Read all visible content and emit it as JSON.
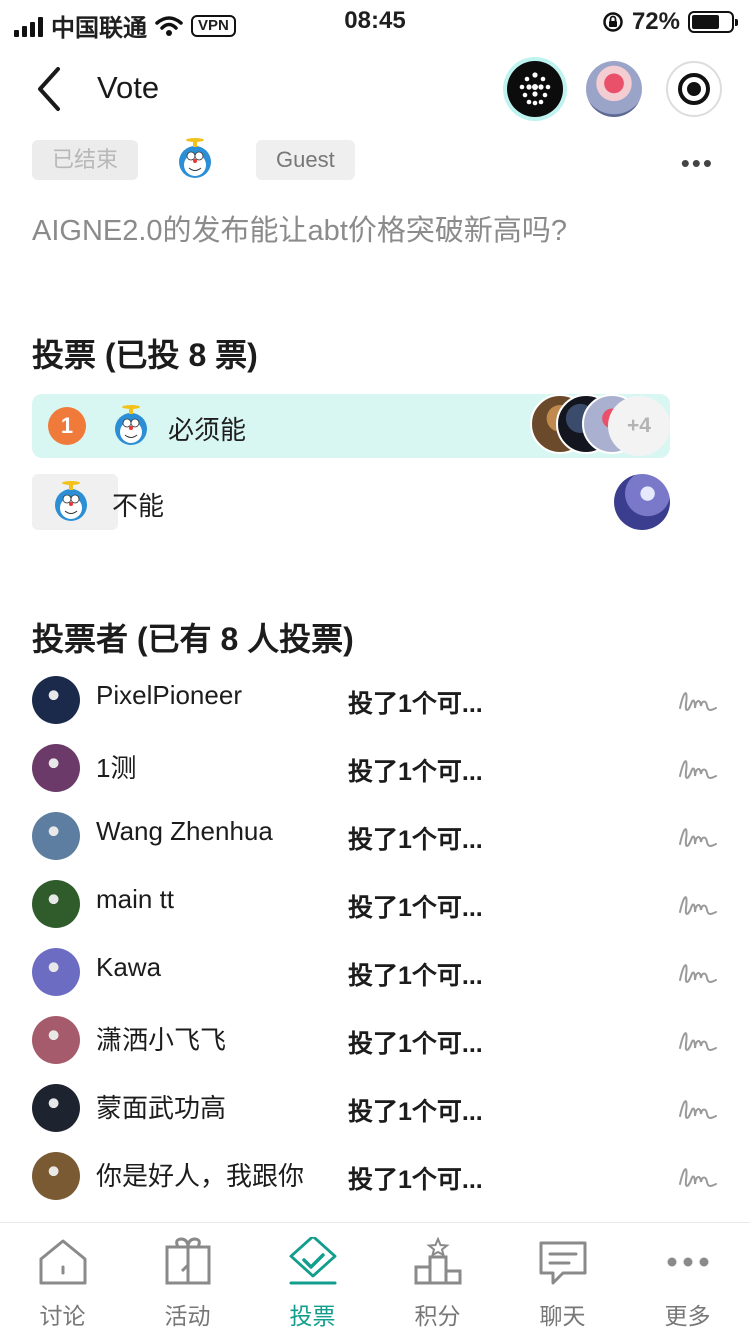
{
  "status_bar": {
    "carrier": "中国联通",
    "vpn": "VPN",
    "time": "08:45",
    "battery": "72%",
    "battery_level": 0.72
  },
  "header": {
    "title": "Vote"
  },
  "post": {
    "status_tag": "已结束",
    "role_tag": "Guest",
    "question": "AIGNE2.0的发布能让abt价格突破新高吗?"
  },
  "vote_section": {
    "title": "投票 (已投 8 票)",
    "options": [
      {
        "rank": "1",
        "label": "必须能",
        "extra_count": "+4"
      },
      {
        "label": "不能"
      }
    ]
  },
  "voters_section": {
    "title": "投票者 (已有 8 人投票)",
    "voters": [
      {
        "name": "PixelPioneer",
        "status": "投了1个可...",
        "avatar_color": "#1b2a4a"
      },
      {
        "name": "1测",
        "status": "投了1个可...",
        "avatar_color": "#6b3a68"
      },
      {
        "name": "Wang Zhenhua",
        "status": "投了1个可...",
        "avatar_color": "#5d7ea0"
      },
      {
        "name": "main tt",
        "status": "投了1个可...",
        "avatar_color": "#2f5c2a"
      },
      {
        "name": "Kawa",
        "status": "投了1个可...",
        "avatar_color": "#6c6cc2"
      },
      {
        "name": "潇洒小飞飞",
        "status": "投了1个可...",
        "avatar_color": "#a55b6b"
      },
      {
        "name": "蒙面武功高",
        "status": "投了1个可...",
        "avatar_color": "#1d2430"
      },
      {
        "name": "你是好人，我跟你",
        "status": "投了1个可...",
        "avatar_color": "#7a5a33"
      }
    ]
  },
  "tabbar": {
    "tabs": [
      {
        "label": "讨论",
        "icon": "house-icon"
      },
      {
        "label": "活动",
        "icon": "gift-icon"
      },
      {
        "label": "投票",
        "icon": "vote-icon",
        "active": true
      },
      {
        "label": "积分",
        "icon": "podium-icon"
      },
      {
        "label": "聊天",
        "icon": "chat-icon"
      },
      {
        "label": "更多",
        "icon": "more-icon"
      }
    ],
    "active_color": "#129e8d"
  }
}
